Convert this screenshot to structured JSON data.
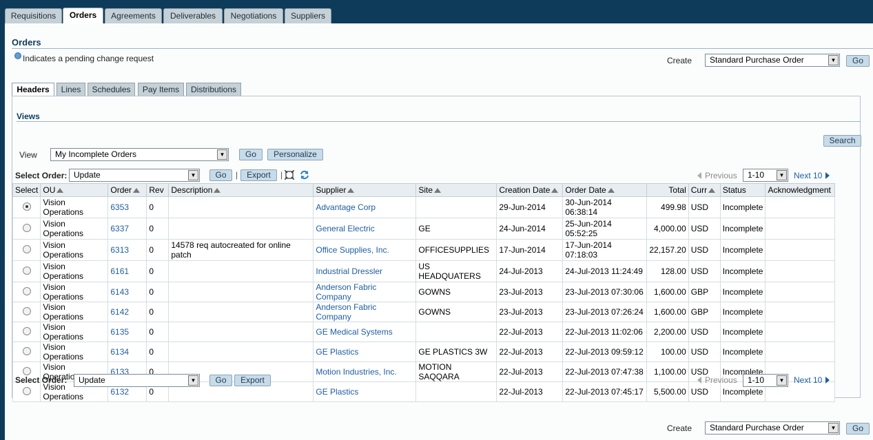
{
  "top_tabs": [
    "Requisitions",
    "Orders",
    "Agreements",
    "Deliverables",
    "Negotiations",
    "Suppliers"
  ],
  "active_top_tab": "Orders",
  "page_title": "Orders",
  "pending_note": "Indicates a pending change request",
  "create": {
    "label": "Create",
    "value": "Standard Purchase Order",
    "go": "Go"
  },
  "sub_tabs": [
    "Headers",
    "Lines",
    "Schedules",
    "Pay Items",
    "Distributions"
  ],
  "active_sub_tab": "Headers",
  "views_title": "Views",
  "search_button": "Search",
  "view": {
    "label": "View",
    "value": "My Incomplete Orders",
    "go": "Go",
    "personalize": "Personalize"
  },
  "select_order": {
    "label": "Select Order:",
    "value": "Update",
    "go": "Go",
    "export": "Export"
  },
  "nav": {
    "previous": "Previous",
    "range": "1-10",
    "next": "Next 10"
  },
  "table": {
    "headers": [
      "Select",
      "OU",
      "Order",
      "Rev",
      "Description",
      "Supplier",
      "Site",
      "Creation Date",
      "Order Date",
      "Total",
      "Curr",
      "Status",
      "Acknowledgment"
    ],
    "rows": [
      {
        "selected": true,
        "ou": "Vision Operations",
        "order": "6353",
        "rev": "0",
        "description": "",
        "supplier": "Advantage Corp",
        "site": "",
        "creation_date": "29-Jun-2014",
        "order_date": "30-Jun-2014 06:38:14",
        "total": "499.98",
        "curr": "USD",
        "status": "Incomplete",
        "ack": ""
      },
      {
        "selected": false,
        "ou": "Vision Operations",
        "order": "6337",
        "rev": "0",
        "description": "",
        "supplier": "General Electric",
        "site": "GE",
        "creation_date": "24-Jun-2014",
        "order_date": "25-Jun-2014 05:52:25",
        "total": "4,000.00",
        "curr": "USD",
        "status": "Incomplete",
        "ack": ""
      },
      {
        "selected": false,
        "ou": "Vision Operations",
        "order": "6313",
        "rev": "0",
        "description": "14578 req autocreated for online patch",
        "supplier": "Office Supplies, Inc.",
        "site": "OFFICESUPPLIES",
        "creation_date": "17-Jun-2014",
        "order_date": "17-Jun-2014 07:18:03",
        "total": "22,157.20",
        "curr": "USD",
        "status": "Incomplete",
        "ack": ""
      },
      {
        "selected": false,
        "ou": "Vision Operations",
        "order": "6161",
        "rev": "0",
        "description": "",
        "supplier": "Industrial Dressler",
        "site": "US HEADQUATERS",
        "creation_date": "24-Jul-2013",
        "order_date": "24-Jul-2013 11:24:49",
        "total": "128.00",
        "curr": "USD",
        "status": "Incomplete",
        "ack": ""
      },
      {
        "selected": false,
        "ou": "Vision Operations",
        "order": "6143",
        "rev": "0",
        "description": "",
        "supplier": "Anderson Fabric Company",
        "site": "GOWNS",
        "creation_date": "23-Jul-2013",
        "order_date": "23-Jul-2013 07:30:06",
        "total": "1,600.00",
        "curr": "GBP",
        "status": "Incomplete",
        "ack": ""
      },
      {
        "selected": false,
        "ou": "Vision Operations",
        "order": "6142",
        "rev": "0",
        "description": "",
        "supplier": "Anderson Fabric Company",
        "site": "GOWNS",
        "creation_date": "23-Jul-2013",
        "order_date": "23-Jul-2013 07:26:24",
        "total": "1,600.00",
        "curr": "GBP",
        "status": "Incomplete",
        "ack": ""
      },
      {
        "selected": false,
        "ou": "Vision Operations",
        "order": "6135",
        "rev": "0",
        "description": "",
        "supplier": "GE Medical Systems",
        "site": "",
        "creation_date": "22-Jul-2013",
        "order_date": "22-Jul-2013 11:02:06",
        "total": "2,200.00",
        "curr": "USD",
        "status": "Incomplete",
        "ack": ""
      },
      {
        "selected": false,
        "ou": "Vision Operations",
        "order": "6134",
        "rev": "0",
        "description": "",
        "supplier": "GE Plastics",
        "site": "GE PLASTICS 3W",
        "creation_date": "22-Jul-2013",
        "order_date": "22-Jul-2013 09:59:12",
        "total": "100.00",
        "curr": "USD",
        "status": "Incomplete",
        "ack": ""
      },
      {
        "selected": false,
        "ou": "Vision Operations",
        "order": "6133",
        "rev": "0",
        "description": "",
        "supplier": "Motion Industries, Inc.",
        "site": "MOTION SAQQARA",
        "creation_date": "22-Jul-2013",
        "order_date": "22-Jul-2013 07:47:38",
        "total": "1,100.00",
        "curr": "USD",
        "status": "Incomplete",
        "ack": ""
      },
      {
        "selected": false,
        "ou": "Vision Operations",
        "order": "6132",
        "rev": "0",
        "description": "",
        "supplier": "GE Plastics",
        "site": "",
        "creation_date": "22-Jul-2013",
        "order_date": "22-Jul-2013 07:45:17",
        "total": "5,500.00",
        "curr": "USD",
        "status": "Incomplete",
        "ack": ""
      }
    ]
  },
  "colors": {
    "brand": "#0e3b5a",
    "link": "#1f5ea3",
    "button": "#c8dbe9",
    "tab": "#c5d0d7"
  },
  "icons": {
    "detach": "detach-table-icon",
    "refresh": "refresh-icon",
    "pending": "pending-change-dot-icon"
  }
}
